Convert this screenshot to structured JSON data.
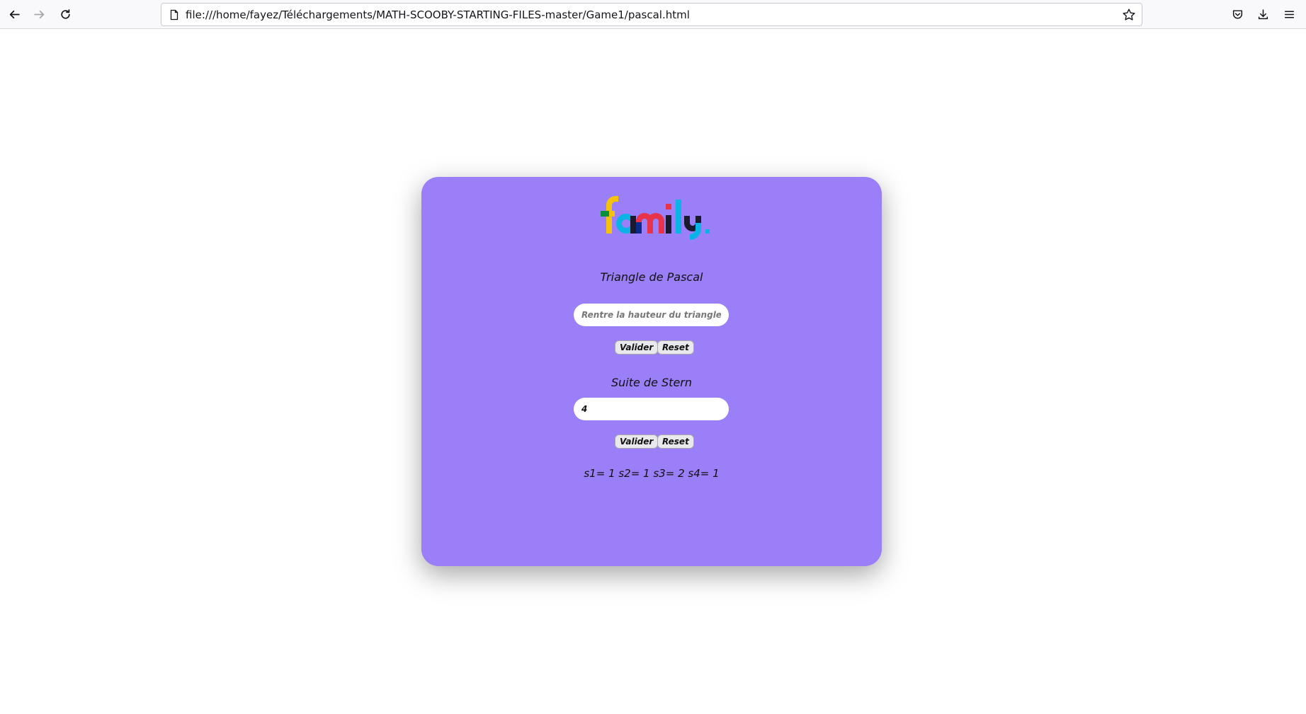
{
  "browser": {
    "url": "file:///home/fayez/Téléchargements/MATH-SCOOBY-STARTING-FILES-master/Game1/pascal.html"
  },
  "page": {
    "logo_text": "family.",
    "pascal": {
      "title": "Triangle de Pascal",
      "input_value": "",
      "input_placeholder": "Rentre la hauteur du triangle!",
      "validate_label": "Valider",
      "reset_label": "Reset"
    },
    "stern": {
      "title": "Suite de Stern",
      "input_value": "4",
      "validate_label": "Valider",
      "reset_label": "Reset",
      "result": "s1= 1 s2= 1 s3= 2 s4= 1"
    }
  },
  "colors": {
    "card_background": "#9b7ff9",
    "logo_f": "#f4c20d",
    "logo_a": "#0ab3e6",
    "logo_m": "#e8344a",
    "logo_i": "#1a1a2e",
    "logo_l": "#0ab3e6",
    "logo_y": "#0ab3e6"
  }
}
